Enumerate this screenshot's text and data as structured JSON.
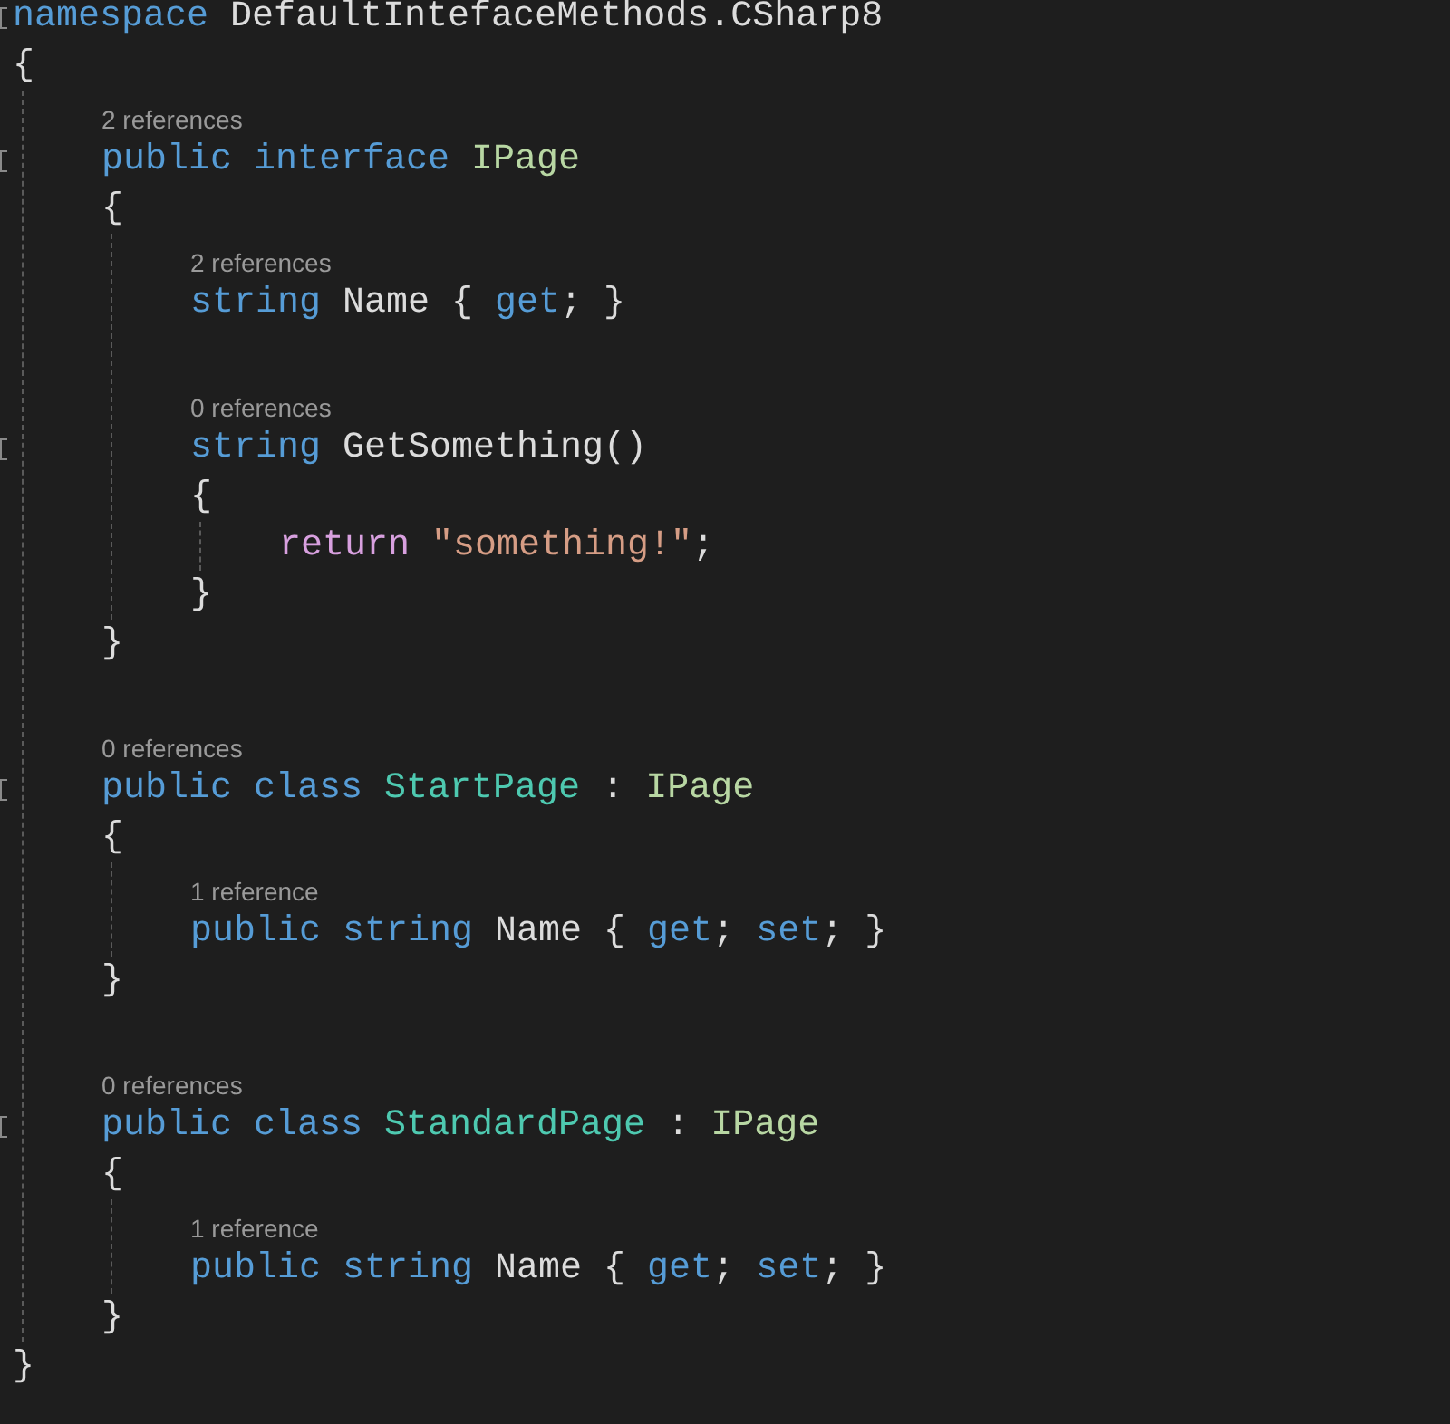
{
  "code": [
    {
      "kind": "line",
      "collapsible": true,
      "tokens": [
        {
          "kind": "keyword",
          "text": "namespace"
        },
        {
          "kind": "plain",
          "text": " DefaultIntefaceMethods.CSharp8"
        }
      ],
      "block": {
        "open": "{",
        "close": "}",
        "children": [
          {
            "kind": "line",
            "lens": "2 references",
            "collapsible": true,
            "tokens": [
              {
                "kind": "keyword",
                "text": "public interface "
              },
              {
                "kind": "interface",
                "text": "IPage"
              }
            ],
            "block": {
              "open": "{",
              "close": "}",
              "children": [
                {
                  "kind": "line",
                  "lens": "2 references",
                  "collapsible": false,
                  "tokens": [
                    {
                      "kind": "keyword",
                      "text": "string"
                    },
                    {
                      "kind": "plain",
                      "text": " Name { "
                    },
                    {
                      "kind": "keyword",
                      "text": "get"
                    },
                    {
                      "kind": "plain",
                      "text": "; }"
                    }
                  ]
                },
                {
                  "kind": "blank"
                },
                {
                  "kind": "line",
                  "lens": "0 references",
                  "collapsible": true,
                  "tokens": [
                    {
                      "kind": "keyword",
                      "text": "string"
                    },
                    {
                      "kind": "plain",
                      "text": " GetSomething()"
                    }
                  ],
                  "block": {
                    "open": "{",
                    "close": "}",
                    "children": [
                      {
                        "kind": "line",
                        "collapsible": false,
                        "tokens": [
                          {
                            "kind": "control",
                            "text": "return "
                          },
                          {
                            "kind": "string",
                            "text": "\"something!\""
                          },
                          {
                            "kind": "plain",
                            "text": ";"
                          }
                        ]
                      }
                    ]
                  }
                }
              ]
            }
          },
          {
            "kind": "blank"
          },
          {
            "kind": "line",
            "lens": "0 references",
            "collapsible": true,
            "tokens": [
              {
                "kind": "keyword",
                "text": "public class "
              },
              {
                "kind": "class",
                "text": "StartPage"
              },
              {
                "kind": "plain",
                "text": " : "
              },
              {
                "kind": "interface",
                "text": "IPage"
              }
            ],
            "block": {
              "open": "{",
              "close": "}",
              "children": [
                {
                  "kind": "line",
                  "lens": "1 reference",
                  "collapsible": false,
                  "tokens": [
                    {
                      "kind": "keyword",
                      "text": "public string"
                    },
                    {
                      "kind": "plain",
                      "text": " Name { "
                    },
                    {
                      "kind": "keyword",
                      "text": "get"
                    },
                    {
                      "kind": "plain",
                      "text": "; "
                    },
                    {
                      "kind": "keyword",
                      "text": "set"
                    },
                    {
                      "kind": "plain",
                      "text": "; }"
                    }
                  ]
                }
              ]
            }
          },
          {
            "kind": "blank"
          },
          {
            "kind": "line",
            "lens": "0 references",
            "collapsible": true,
            "tokens": [
              {
                "kind": "keyword",
                "text": "public class "
              },
              {
                "kind": "class",
                "text": "StandardPage"
              },
              {
                "kind": "plain",
                "text": " : "
              },
              {
                "kind": "interface",
                "text": "IPage"
              }
            ],
            "block": {
              "open": "{",
              "close": "}",
              "children": [
                {
                  "kind": "line",
                  "lens": "1 reference",
                  "collapsible": false,
                  "tokens": [
                    {
                      "kind": "keyword",
                      "text": "public string"
                    },
                    {
                      "kind": "plain",
                      "text": " Name { "
                    },
                    {
                      "kind": "keyword",
                      "text": "get"
                    },
                    {
                      "kind": "plain",
                      "text": "; "
                    },
                    {
                      "kind": "keyword",
                      "text": "set"
                    },
                    {
                      "kind": "plain",
                      "text": "; }"
                    }
                  ]
                }
              ]
            }
          }
        ]
      }
    }
  ]
}
